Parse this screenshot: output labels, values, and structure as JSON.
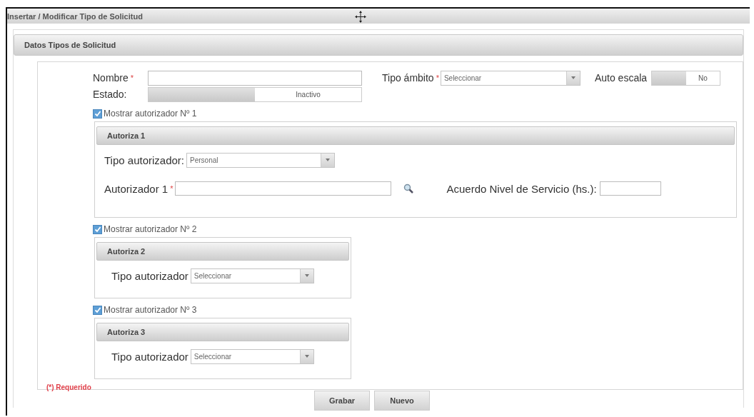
{
  "window": {
    "title": "Insertar / Modificar Tipo de Solicitud"
  },
  "panel": {
    "title": "Datos Tipos de Solicitud"
  },
  "main_fields": {
    "nombre": {
      "label": "Nombre",
      "mark": "*"
    },
    "tipo_ambito": {
      "label": "Tipo ámbito",
      "mark": "*",
      "value": "Seleccionar"
    },
    "auto_escala": {
      "label": "Auto escala",
      "on": false,
      "text": "No"
    },
    "estado": {
      "label": "Estado:",
      "on": false,
      "text": "Inactivo"
    }
  },
  "authorizers": [
    {
      "checkbox_label": "Mostrar autorizador Nº 1",
      "checked": true,
      "title": "Autoriza 1",
      "tipo_label": "Tipo autorizador:",
      "tipo_value": "Personal",
      "autorizador": {
        "label": "Autorizador 1",
        "mark": "*"
      },
      "acuerdo": {
        "label": "Acuerdo Nivel de Servicio (hs.):"
      }
    },
    {
      "checkbox_label": "Mostrar autorizador Nº 2",
      "checked": true,
      "title": "Autoriza 2",
      "tipo_label": "Tipo autorizador",
      "tipo_value": "Seleccionar"
    },
    {
      "checkbox_label": "Mostrar autorizador Nº 3",
      "checked": true,
      "title": "Autoriza 3",
      "tipo_label": "Tipo autorizador",
      "tipo_value": "Seleccionar"
    }
  ],
  "required_note": "(*) Requerido",
  "buttons": [
    "Grabar",
    "Nuevo"
  ]
}
